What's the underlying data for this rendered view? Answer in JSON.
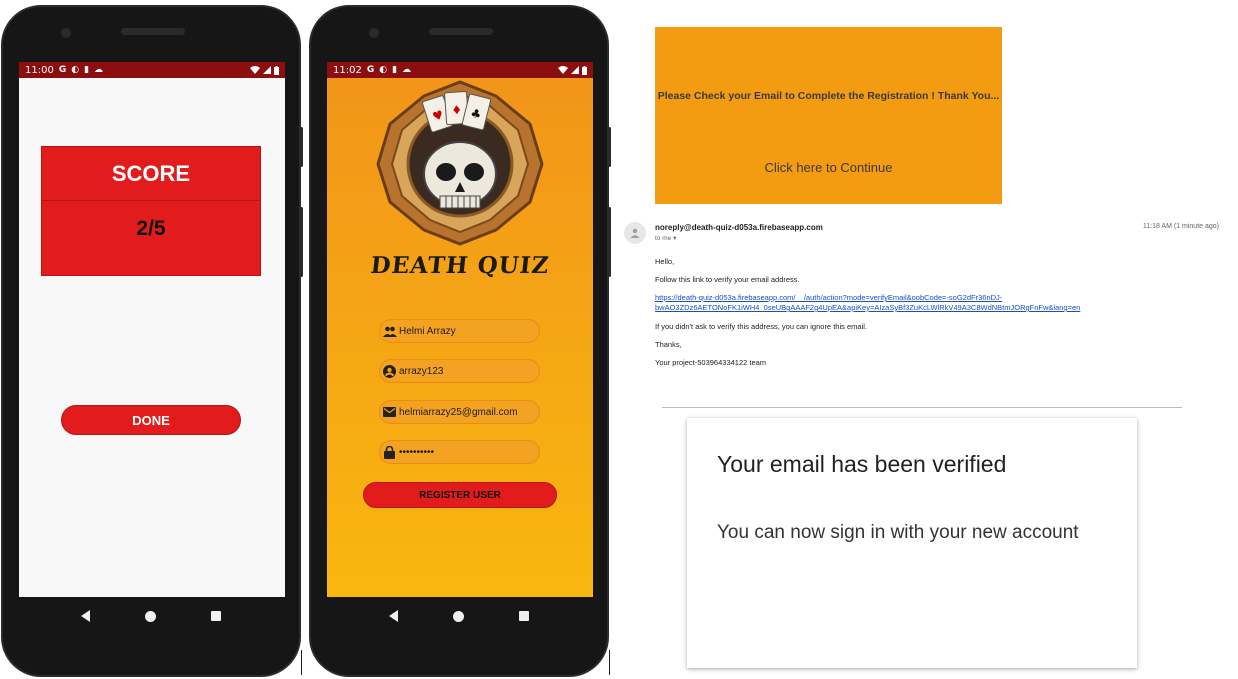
{
  "phone1": {
    "status": {
      "time": "11:00",
      "icons": [
        "G",
        "◐",
        "▮",
        "☁"
      ]
    },
    "score_title": "SCORE",
    "score_value": "2/5",
    "done_label": "DONE"
  },
  "phone2": {
    "status": {
      "time": "11:02",
      "icons": [
        "G",
        "◐",
        "▮",
        "☁"
      ]
    },
    "title": "DEATH QUIZ",
    "fields": {
      "name": "Helmi Arrazy",
      "username": "arrazy123",
      "email": "helmiarrazy25@gmail.com",
      "password": "••••••••••"
    },
    "register_label": "REGISTER USER"
  },
  "banner": {
    "message": "Please Check your Email to Complete the Registration ! Thank You...",
    "link": "Click here to Continue"
  },
  "email": {
    "sender": "noreply@death-quiz-d053a.firebaseapp.com",
    "to": "to me",
    "time": "11:18 AM (1 minute ago)",
    "greeting": "Hello,",
    "instruction": "Follow this link to verify your email address.",
    "link": "https://death-quiz-d053a.firebaseapp.com/__/auth/action?mode=verifyEmail&oobCode=-soG2dFr36nDJ-bwAO3ZDz6AETONoFK1iWH4_0seUBgAAAF2g4UpEA&apiKey=AIzaSyBf3ZuKcLWlRkV49A3C8WdNBtmJORgFnFw&lang=en",
    "ignore": "If you didn't ask to verify this address, you can ignore this email.",
    "thanks": "Thanks,",
    "team": "Your project-503964334122 team"
  },
  "verified": {
    "title": "Your email has been verified",
    "subtitle": "You can now sign in with your new account"
  },
  "colors": {
    "red": "#e21c1c",
    "orange": "#f39c12",
    "dark_red": "#8c0f0f"
  },
  "icons": [
    "back-icon",
    "home-icon",
    "recents-icon",
    "people-icon",
    "account-circle-icon",
    "mail-icon",
    "lock-icon",
    "skull-logo-icon",
    "person-icon"
  ]
}
